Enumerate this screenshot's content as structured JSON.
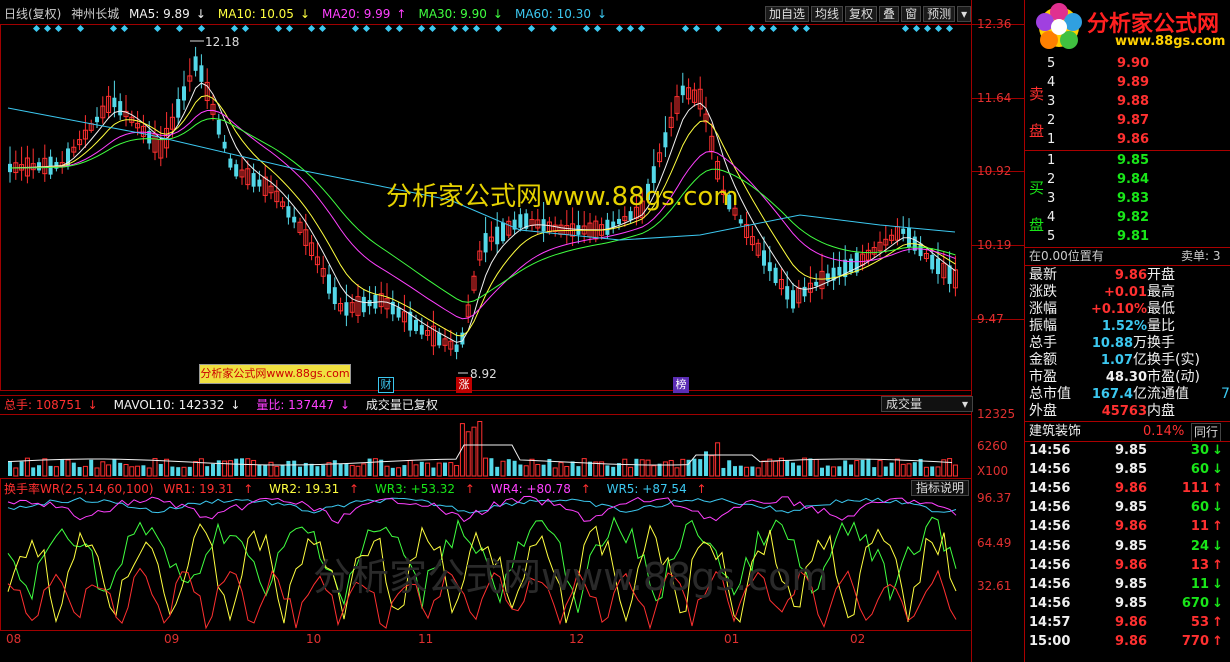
{
  "header": {
    "period": "日线(复权)",
    "stock_name": "神州长城",
    "ma": [
      {
        "label": "MA5: 9.89",
        "arrow": "↓",
        "color": "#f0f0f0"
      },
      {
        "label": "MA10: 10.05",
        "arrow": "↓",
        "color": "#ffff40"
      },
      {
        "label": "MA20: 9.99",
        "arrow": "↑",
        "color": "#ff40ff"
      },
      {
        "label": "MA30: 9.90",
        "arrow": "↓",
        "color": "#40ff40"
      },
      {
        "label": "MA60: 10.30",
        "arrow": "↓",
        "color": "#3cc8f0"
      }
    ]
  },
  "toolbar": {
    "buttons": [
      "加自选",
      "均线",
      "复权",
      "叠",
      "窗",
      "预测"
    ],
    "dropdown": "▾"
  },
  "price_axis": [
    "12.36",
    "11.64",
    "10.92",
    "10.19",
    "9.47"
  ],
  "annotations": {
    "high": "12.18",
    "low": "8.92"
  },
  "events": [
    {
      "label": "财",
      "color": "#3cc8f0",
      "bg": "#000"
    },
    {
      "label": "涨",
      "color": "#fff",
      "bg": "#c00000"
    },
    {
      "label": "榜",
      "color": "#fff",
      "bg": "#5b2db5"
    }
  ],
  "watermark_small": "分析家公式网www.88gs.com",
  "watermark_main": "分析家公式网www.88gs.com",
  "watermark_indicator": "分析家公式网www.88gs.com",
  "volume": {
    "total_label": "总手: 108751",
    "total_arrow": "↓",
    "mavol_label": "MAVOL10: 142332",
    "mavol_arrow": "↓",
    "ratio_label": "量比: 137447",
    "ratio_arrow": "↓",
    "note": "成交量已复权",
    "selector": "成交量",
    "axis": [
      "12325",
      "6260",
      "X100"
    ]
  },
  "indicator": {
    "name": "换手率WR(2,5,14,60,100)",
    "wr1": "WR1: 19.31",
    "wr1_arrow": "↑",
    "wr2": "WR2: 19.31",
    "wr2_arrow": "↑",
    "wr3": "WR3: +53.32",
    "wr3_arrow": "↑",
    "wr4": "WR4: +80.78",
    "wr4_arrow": "↑",
    "wr5": "WR5: +87.54",
    "wr5_arrow": "↑",
    "explain_button": "指标说明",
    "axis": [
      "96.37",
      "64.49",
      "32.61"
    ]
  },
  "time_axis": [
    "08",
    "09",
    "10",
    "11",
    "12",
    "01",
    "02"
  ],
  "right_panel": {
    "logo_text": "分析家公式网",
    "logo_url": "www.88gs.com",
    "sell_label": [
      "卖",
      "盘"
    ],
    "buy_label": [
      "买",
      "盘"
    ],
    "sell": [
      {
        "level": "5",
        "price": "9.90"
      },
      {
        "level": "4",
        "price": "9.89"
      },
      {
        "level": "3",
        "price": "9.88"
      },
      {
        "level": "2",
        "price": "9.87"
      },
      {
        "level": "1",
        "price": "9.86"
      }
    ],
    "buy": [
      {
        "level": "1",
        "price": "9.85"
      },
      {
        "level": "2",
        "price": "9.84"
      },
      {
        "level": "3",
        "price": "9.83"
      },
      {
        "level": "4",
        "price": "9.82"
      },
      {
        "level": "5",
        "price": "9.81"
      }
    ],
    "position_left": "在0.00位置有",
    "position_right": "卖单: 3",
    "quote_rows": [
      {
        "l": "最新",
        "v": "9.86",
        "vc": "red",
        "r": "开盘"
      },
      {
        "l": "涨跌",
        "v": "+0.01",
        "vc": "red",
        "r": "最高"
      },
      {
        "l": "涨幅",
        "v": "+0.10%",
        "vc": "red",
        "r": "最低"
      },
      {
        "l": "振幅",
        "v": "1.52%",
        "vc": "cyan",
        "r": "量比"
      },
      {
        "l": "总手",
        "v": "10.88",
        "vc": "cyan",
        "unit": "万",
        "r": "换手"
      },
      {
        "l": "金额",
        "v": "1.07",
        "vc": "cyan",
        "unit": "亿",
        "r": "换手(实)"
      },
      {
        "l": "市盈",
        "v": "48.30",
        "vc": "white",
        "r": "市盈(动)"
      },
      {
        "l": "总市值",
        "v": "167.4",
        "vc": "cyan",
        "unit": "亿",
        "r": "流通值",
        "r2": "7"
      },
      {
        "l": "外盘",
        "v": "45763",
        "vc": "red",
        "r": "内盘"
      }
    ],
    "sector": {
      "name": "建筑装饰",
      "change": "0.14%",
      "peer": "同行"
    },
    "trades": [
      {
        "t": "14:56",
        "p": "9.85",
        "pc": "white",
        "v": "30",
        "vc": "green",
        "a": "↓",
        "ac": "green"
      },
      {
        "t": "14:56",
        "p": "9.85",
        "pc": "white",
        "v": "60",
        "vc": "green",
        "a": "↓",
        "ac": "green"
      },
      {
        "t": "14:56",
        "p": "9.86",
        "pc": "red",
        "v": "111",
        "vc": "red",
        "a": "↑",
        "ac": "red"
      },
      {
        "t": "14:56",
        "p": "9.85",
        "pc": "white",
        "v": "60",
        "vc": "green",
        "a": "↓",
        "ac": "green"
      },
      {
        "t": "14:56",
        "p": "9.86",
        "pc": "red",
        "v": "11",
        "vc": "red",
        "a": "↑",
        "ac": "red"
      },
      {
        "t": "14:56",
        "p": "9.85",
        "pc": "white",
        "v": "24",
        "vc": "green",
        "a": "↓",
        "ac": "green"
      },
      {
        "t": "14:56",
        "p": "9.86",
        "pc": "red",
        "v": "13",
        "vc": "red",
        "a": "↑",
        "ac": "red"
      },
      {
        "t": "14:56",
        "p": "9.85",
        "pc": "white",
        "v": "11",
        "vc": "green",
        "a": "↓",
        "ac": "green"
      },
      {
        "t": "14:56",
        "p": "9.85",
        "pc": "white",
        "v": "670",
        "vc": "green",
        "a": "↓",
        "ac": "green"
      },
      {
        "t": "14:57",
        "p": "9.86",
        "pc": "red",
        "v": "53",
        "vc": "red",
        "a": "↑",
        "ac": "red"
      },
      {
        "t": "15:00",
        "p": "9.86",
        "pc": "red",
        "v": "770",
        "vc": "red",
        "a": "↑",
        "ac": "red"
      }
    ]
  }
}
